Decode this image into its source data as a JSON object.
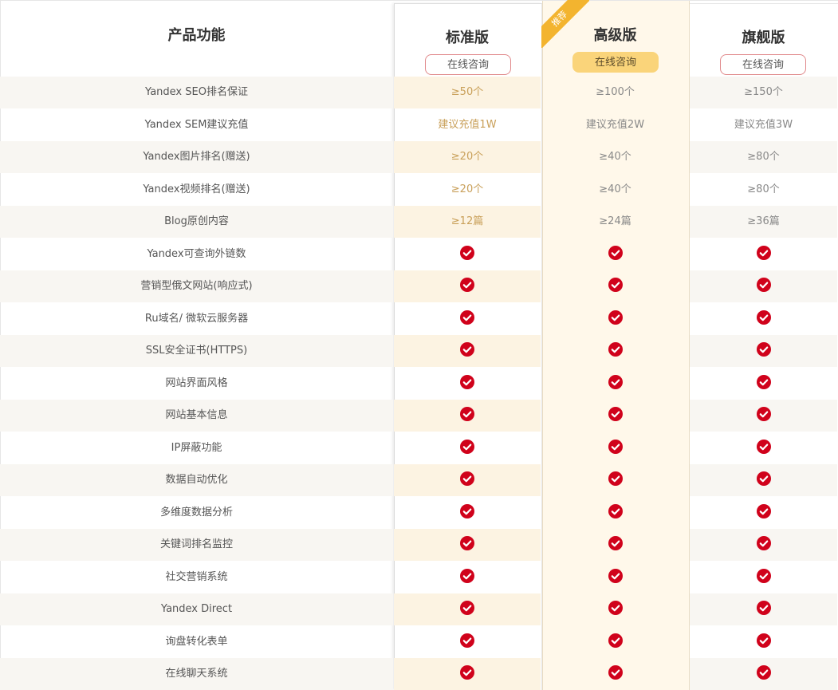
{
  "header": {
    "feature_title": "产品功能",
    "plans": [
      {
        "name": "标准版",
        "button": "在线咨询"
      },
      {
        "name": "高级版",
        "button": "在线咨询",
        "badge": "推荐"
      },
      {
        "name": "旗舰版",
        "button": "在线咨询"
      }
    ]
  },
  "rows": [
    {
      "feature": "Yandex SEO排名保证",
      "std": "≥50个",
      "adv": "≥100个",
      "flag": "≥150个"
    },
    {
      "feature": "Yandex SEM建议充值",
      "std": "建议充值1W",
      "adv": "建议充值2W",
      "flag": "建议充值3W"
    },
    {
      "feature": "Yandex图片排名(赠送)",
      "std": "≥20个",
      "adv": "≥40个",
      "flag": "≥80个"
    },
    {
      "feature": "Yandex视频排名(赠送)",
      "std": "≥20个",
      "adv": "≥40个",
      "flag": "≥80个"
    },
    {
      "feature": "Blog原创内容",
      "std": "≥12篇",
      "adv": "≥24篇",
      "flag": "≥36篇"
    },
    {
      "feature": "Yandex可查询外链数",
      "check": true
    },
    {
      "feature": "营销型俄文网站(响应式)",
      "check": true
    },
    {
      "feature": "Ru域名/ 微软云服务器",
      "check": true
    },
    {
      "feature": "SSL安全证书(HTTPS)",
      "check": true
    },
    {
      "feature": "网站界面风格",
      "check": true
    },
    {
      "feature": "网站基本信息",
      "check": true
    },
    {
      "feature": "IP屏蔽功能",
      "check": true
    },
    {
      "feature": "数据自动优化",
      "check": true
    },
    {
      "feature": "多维度数据分析",
      "check": true
    },
    {
      "feature": "关键词排名监控",
      "check": true
    },
    {
      "feature": "社交营销系统",
      "check": true
    },
    {
      "feature": "Yandex Direct",
      "check": true
    },
    {
      "feature": "询盘转化表单",
      "check": true
    },
    {
      "feature": "在线聊天系统",
      "check": true
    }
  ],
  "colors": {
    "check": "#d0021b",
    "ribbon": "#f3b42f",
    "primary_button": "#fad47a",
    "std_text": "#c9a05a"
  },
  "icons": {
    "check": "check-circle-icon"
  }
}
